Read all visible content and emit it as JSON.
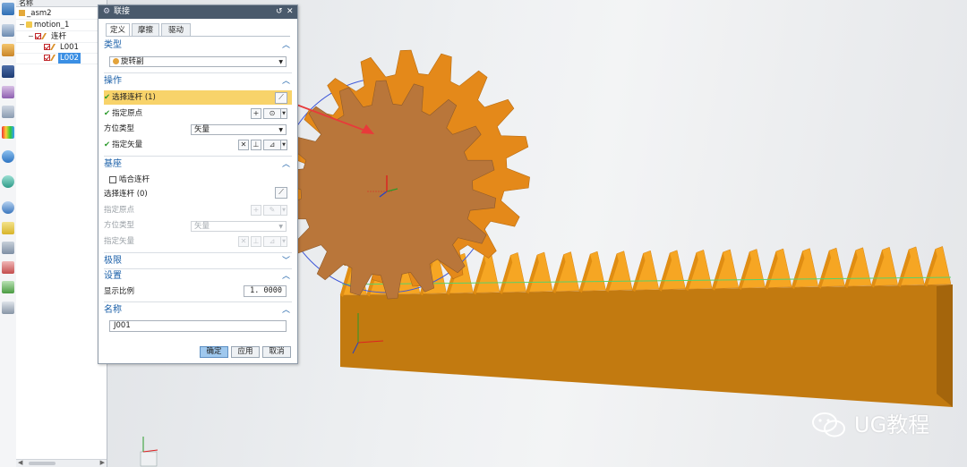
{
  "navigator": {
    "header": "名称",
    "items": [
      {
        "label": "_asm2",
        "level": 0
      },
      {
        "label": "motion_1",
        "level": 0
      },
      {
        "label": "连杆",
        "level": 1
      },
      {
        "label": "L001",
        "level": 2
      },
      {
        "label": "L002",
        "level": 2,
        "selected": true
      }
    ]
  },
  "dialog": {
    "title": "联接",
    "tabs": [
      "定义",
      "摩擦",
      "驱动"
    ],
    "active_tab": "定义",
    "type_section": {
      "title": "类型",
      "value": "旋转副"
    },
    "operation_section": {
      "title": "操作",
      "select_link": "选择连杆 (1)",
      "specify_origin": "指定原点",
      "orientation_type_label": "方位类型",
      "orientation_type_value": "矢量",
      "specify_vector": "指定矢量"
    },
    "base_section": {
      "title": "基座",
      "engage_link": "啮合连杆",
      "select_link": "选择连杆 (0)",
      "specify_origin": "指定原点",
      "orientation_type_label": "方位类型",
      "orientation_type_value": "矢量",
      "specify_vector": "指定矢量"
    },
    "limits_section": {
      "title": "极限"
    },
    "settings_section": {
      "title": "设置",
      "display_scale_label": "显示比例",
      "display_scale_value": "1. 0000"
    },
    "name_section": {
      "title": "名称",
      "value": "J001"
    },
    "buttons": {
      "ok": "确定",
      "apply": "应用",
      "cancel": "取消"
    }
  },
  "watermark": {
    "text": "UG教程"
  },
  "colors": {
    "gear_orange": "#f29a1e",
    "gear_face": "#b9763a",
    "rack_front": "#c27a10",
    "rack_teeth": "#f6a623",
    "titlebar": "#4a5a6c",
    "highlight": "#f8d36a",
    "section_blue": "#1a5fa8"
  }
}
